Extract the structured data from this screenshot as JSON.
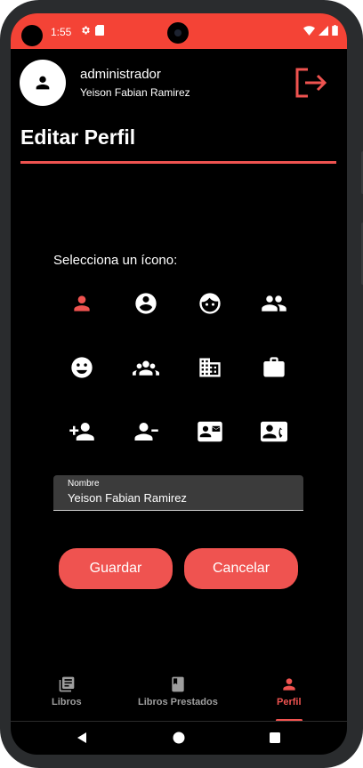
{
  "status_bar": {
    "time": "1:55",
    "color": "#f44336"
  },
  "header": {
    "role": "administrador",
    "user_name": "Yeison Fabian Ramirez",
    "logout_icon": "logout-icon"
  },
  "page": {
    "title": "Editar Perfil",
    "accent": "#ef5350"
  },
  "icon_picker": {
    "label": "Selecciona un ícono:",
    "selected_index": 0,
    "icons": [
      "person-icon",
      "account-circle-icon",
      "face-icon",
      "people-icon",
      "mood-icon",
      "group-icon",
      "business-icon",
      "work-icon",
      "person-add-icon",
      "person-remove-icon",
      "contact-mail-icon",
      "contact-phone-icon"
    ]
  },
  "form": {
    "name_label": "Nombre",
    "name_value": "Yeison Fabian Ramirez"
  },
  "buttons": {
    "save_label": "Guardar",
    "cancel_label": "Cancelar"
  },
  "bottom_nav": {
    "items": [
      {
        "label": "Libros",
        "icon": "library-books-icon"
      },
      {
        "label": "Libros Prestados",
        "icon": "book-icon"
      },
      {
        "label": "Perfil",
        "icon": "person-icon"
      }
    ],
    "active_index": 2
  }
}
